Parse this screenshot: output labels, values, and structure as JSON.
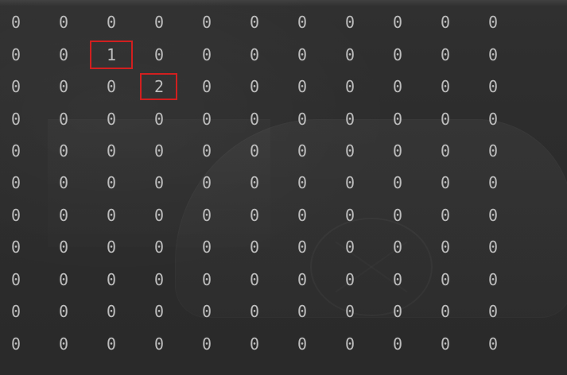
{
  "matrix": [
    [
      "0",
      "0",
      "0",
      "0",
      "0",
      "0",
      "0",
      "0",
      "0",
      "0",
      "0"
    ],
    [
      "0",
      "0",
      "1",
      "0",
      "0",
      "0",
      "0",
      "0",
      "0",
      "0",
      "0"
    ],
    [
      "0",
      "0",
      "0",
      "2",
      "0",
      "0",
      "0",
      "0",
      "0",
      "0",
      "0"
    ],
    [
      "0",
      "0",
      "0",
      "0",
      "0",
      "0",
      "0",
      "0",
      "0",
      "0",
      "0"
    ],
    [
      "0",
      "0",
      "0",
      "0",
      "0",
      "0",
      "0",
      "0",
      "0",
      "0",
      "0"
    ],
    [
      "0",
      "0",
      "0",
      "0",
      "0",
      "0",
      "0",
      "0",
      "0",
      "0",
      "0"
    ],
    [
      "0",
      "0",
      "0",
      "0",
      "0",
      "0",
      "0",
      "0",
      "0",
      "0",
      "0"
    ],
    [
      "0",
      "0",
      "0",
      "0",
      "0",
      "0",
      "0",
      "0",
      "0",
      "0",
      "0"
    ],
    [
      "0",
      "0",
      "0",
      "0",
      "0",
      "0",
      "0",
      "0",
      "0",
      "0",
      "0"
    ],
    [
      "0",
      "0",
      "0",
      "0",
      "0",
      "0",
      "0",
      "0",
      "0",
      "0",
      "0"
    ],
    [
      "0",
      "0",
      "0",
      "0",
      "0",
      "0",
      "0",
      "0",
      "0",
      "0",
      "0"
    ]
  ],
  "highlight_color": "#d11f1f",
  "text_color": "#bdbdbd",
  "background_color": "#2b2b2b"
}
